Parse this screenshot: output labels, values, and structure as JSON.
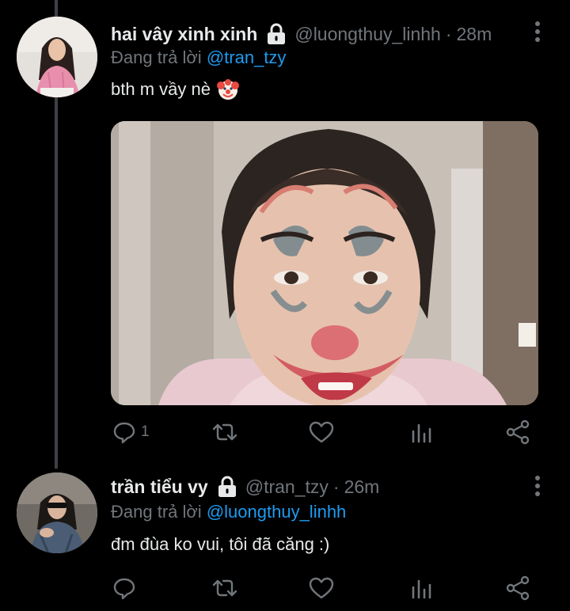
{
  "tweets": [
    {
      "display_name": "hai vây xinh xinh",
      "handle": "@luongthuy_linhh",
      "separator": "·",
      "time": "28m",
      "reply_prefix": "Đang trả lời",
      "reply_to": "@tran_tzy",
      "text": "bth m vầy nè",
      "emoji": "clown-face-icon",
      "has_media": true,
      "reply_count": "1"
    },
    {
      "display_name": "trần tiểu vy",
      "handle": "@tran_tzy",
      "separator": "·",
      "time": "26m",
      "reply_prefix": "Đang trả lời",
      "reply_to": "@luongthuy_linhh",
      "text": "đm đùa ko vui, tôi đã căng :)",
      "has_media": false,
      "reply_count": ""
    }
  ],
  "colors": {
    "background": "#000000",
    "primary_text": "#e7e9ea",
    "secondary_text": "#71767b",
    "link": "#1d9bf0",
    "thread_line": "#3e4144"
  }
}
